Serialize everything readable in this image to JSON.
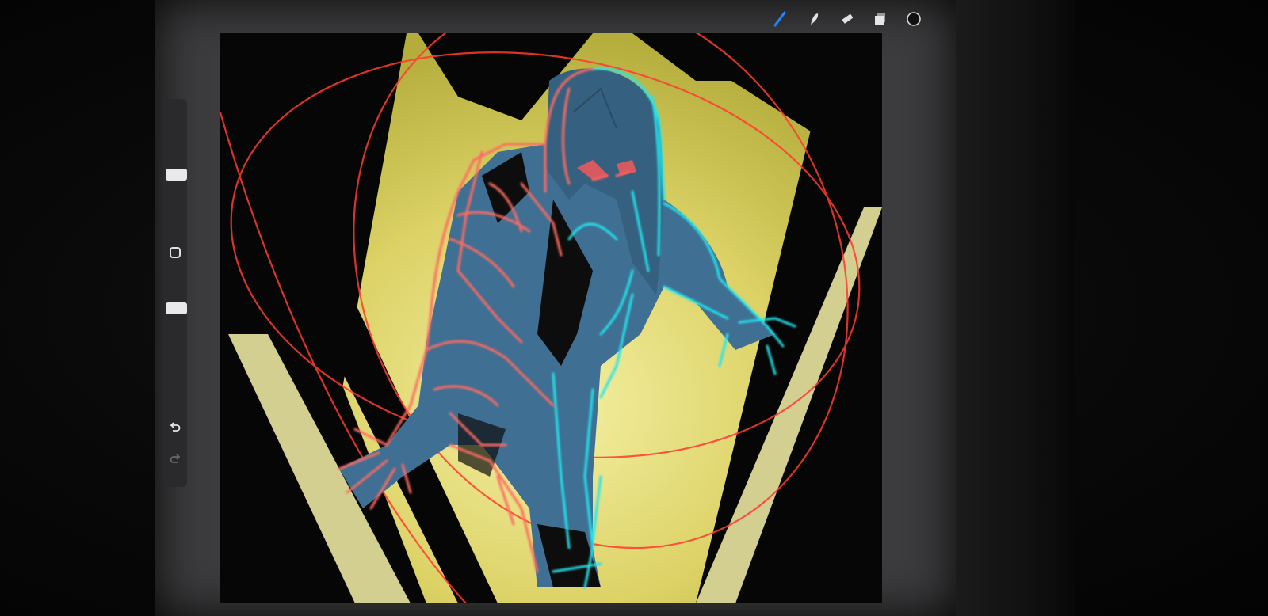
{
  "app": {
    "toolbar": {
      "icons": [
        "brush-icon",
        "smudge-icon",
        "eraser-icon",
        "layers-icon",
        "color-swatch-icon"
      ],
      "active_color": "#1e88ff"
    },
    "sidebar": {
      "icons": [
        "brush-size-slider",
        "modify-square-icon",
        "opacity-slider",
        "undo-icon",
        "redo-icon"
      ]
    },
    "canvas": {
      "background_gradient": [
        "#c8c050",
        "#f2ee9a"
      ],
      "line_colors": {
        "warm": "#ff5a5a",
        "cool": "#23e6ee",
        "fill": "#3f6f93",
        "shadow": "#0a0a0a"
      }
    }
  }
}
